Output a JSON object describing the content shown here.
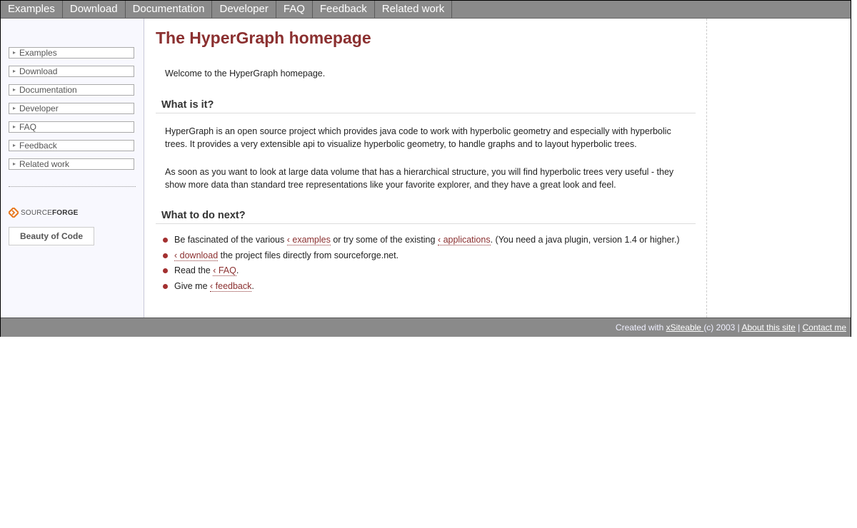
{
  "topnav": {
    "items": [
      "Examples",
      "Download",
      "Documentation",
      "Developer",
      "FAQ",
      "Feedback",
      "Related work"
    ]
  },
  "sidebar": {
    "items": [
      "Examples",
      "Download",
      "Documentation",
      "Developer",
      "FAQ",
      "Feedback",
      "Related work"
    ],
    "sourceforge_prefix": "SOURCE",
    "sourceforge_suffix": "FORGE",
    "beauty_label": "Beauty of Code"
  },
  "main": {
    "title": "The HyperGraph homepage",
    "welcome": "Welcome to the HyperGraph homepage.",
    "section1": {
      "heading": "What is it?",
      "para1": "HyperGraph is an open source project which provides java code to work with hyperbolic geometry and especially with hyperbolic trees. It provides a very extensible api to visualize hyperbolic geometry, to handle graphs and to layout hyperbolic trees.",
      "para2": "As soon as you want to look at large data volume that has a hierarchical structure, you will find hyperbolic trees very useful - they show more data than standard tree representations like your favorite explorer, and they have a great look and feel."
    },
    "section2": {
      "heading": "What to do next?",
      "item1": {
        "pre": "Be fascinated of the various ",
        "link1": "‹ examples",
        "mid": " or try some of the existing ",
        "link2": "‹ applications",
        "post": ". (You need a java plugin, version 1.4 or higher.)"
      },
      "item2": {
        "link": "‹ download",
        "post": " the project files directly from sourceforge.net."
      },
      "item3": {
        "pre": "Read the ",
        "link": "‹ FAQ",
        "post": "."
      },
      "item4": {
        "pre": "Give me ",
        "link": "‹ feedback",
        "post": "."
      }
    }
  },
  "footer": {
    "created_with": "Created with ",
    "xsiteable": "xSiteable ",
    "copyright": "(c) 2003 | ",
    "about": "About this site",
    "separator": " | ",
    "contact": "Contact me"
  },
  "colors": {
    "nav_bg": "#8a8a8a",
    "title": "#8b3030",
    "bullet": "#a33030",
    "sidebar_bg": "#f8f8fe",
    "sourceforge_orange": "#e8751a"
  },
  "icons": {
    "sidebar_bullet": "small-arrow-bullet-icon",
    "sourceforge": "sourceforge-logo-icon",
    "list_bullet": "red-dot-bullet-icon"
  }
}
